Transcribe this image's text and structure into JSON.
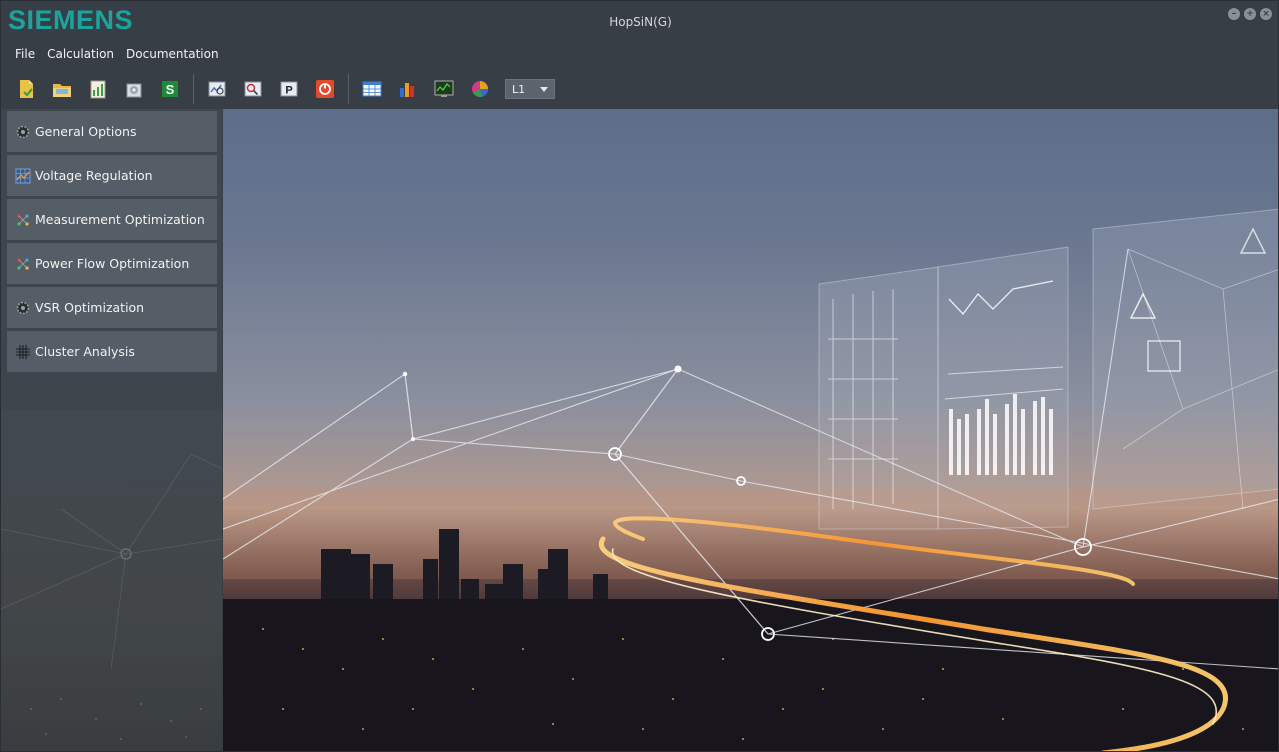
{
  "window": {
    "title": "HopSiN(G)",
    "logo": "SIEMENS",
    "controls": [
      "minimize",
      "maximize",
      "close"
    ]
  },
  "menu": [
    {
      "label": "File"
    },
    {
      "label": "Calculation"
    },
    {
      "label": "Documentation"
    }
  ],
  "toolbar": {
    "buttons": [
      {
        "icon": "new-file-icon"
      },
      {
        "icon": "open-folder-icon"
      },
      {
        "icon": "edit-chart-icon"
      },
      {
        "icon": "settings-gear-icon"
      },
      {
        "icon": "s-green-icon"
      },
      {
        "icon": "zoom-magnifier-icon"
      },
      {
        "icon": "zoom-network-icon"
      },
      {
        "icon": "p-report-icon"
      },
      {
        "icon": "power-stop-icon"
      },
      {
        "icon": "table-grid-icon"
      },
      {
        "icon": "bar-chart-icon"
      },
      {
        "icon": "monitor-chart-icon"
      },
      {
        "icon": "pie-chart-icon"
      }
    ],
    "phase_select": {
      "value": "L1"
    }
  },
  "sidebar": {
    "items": [
      {
        "label": "General Options",
        "icon": "gear-icon"
      },
      {
        "label": "Voltage Regulation",
        "icon": "grid-chart-icon"
      },
      {
        "label": "Measurement Optimization",
        "icon": "nodes-icon"
      },
      {
        "label": "Power Flow Optimization",
        "icon": "nodes-icon"
      },
      {
        "label": "VSR Optimization",
        "icon": "gear-icon"
      },
      {
        "label": "Cluster Analysis",
        "icon": "hash-grid-icon"
      }
    ]
  },
  "colors": {
    "brand": "#1ba39c",
    "window_bg": "#383e45",
    "nav_item_bg": "#555d66",
    "toolbar_select_bg": "#5b636c"
  }
}
